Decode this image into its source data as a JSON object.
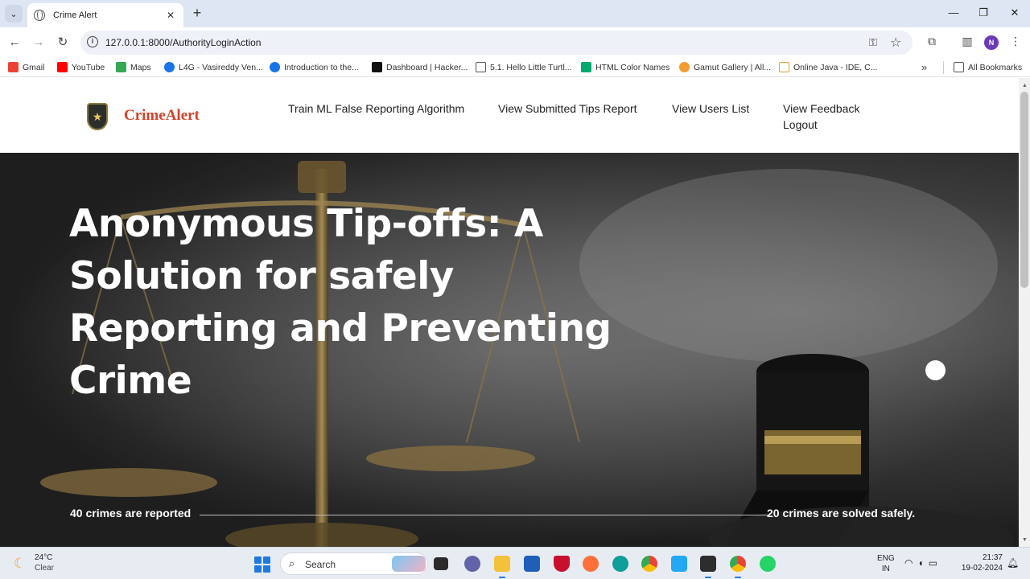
{
  "browser": {
    "tab_title": "Crime Alert",
    "url": "127.0.0.1:8000/AuthorityLoginAction",
    "profile_initial": "N",
    "bookmarks": [
      {
        "label": "Gmail",
        "icon": "gmail-icon",
        "color": "#ea4335"
      },
      {
        "label": "YouTube",
        "icon": "youtube-icon",
        "color": "#ff0000"
      },
      {
        "label": "Maps",
        "icon": "maps-icon",
        "color": "#34a853"
      },
      {
        "label": "L4G - Vasireddy Ven...",
        "icon": "l4g-icon",
        "color": "#1a73e8"
      },
      {
        "label": "Introduction to the...",
        "icon": "course-icon",
        "color": "#1a73e8"
      },
      {
        "label": "Dashboard | Hacker...",
        "icon": "hackerrank-icon",
        "color": "#111111"
      },
      {
        "label": "5.1. Hello Little Turtl...",
        "icon": "doc-icon",
        "color": "#555555"
      },
      {
        "label": "HTML Color Names",
        "icon": "w3-icon",
        "color": "#04aa6d"
      },
      {
        "label": "Gamut Gallery | All...",
        "icon": "gamut-icon",
        "color": "#f29b30"
      },
      {
        "label": "Online Java - IDE, C...",
        "icon": "java-icon",
        "color": "#e0a030"
      }
    ],
    "all_bookmarks_label": "All Bookmarks"
  },
  "site": {
    "brand": "CrimeAlert",
    "nav": [
      "Train ML False Reporting Algorithm",
      "View Submitted Tips Report",
      "View Users List",
      "View Feedback",
      "Logout"
    ]
  },
  "hero": {
    "headline": "Anonymous Tip-offs: A Solution for safely Reporting and Preventing Crime",
    "stat_left": "40  crimes are reported",
    "stat_right": "20 crimes are solved safely."
  },
  "taskbar": {
    "temperature": "24°C",
    "weather": "Clear",
    "search_label": "Search",
    "lang_top": "ENG",
    "lang_bottom": "IN",
    "time": "21:37",
    "date": "19-02-2024"
  },
  "colors": {
    "brand": "#d0442a",
    "hero_text": "#ffffff",
    "accent": "#1f7ae0"
  }
}
